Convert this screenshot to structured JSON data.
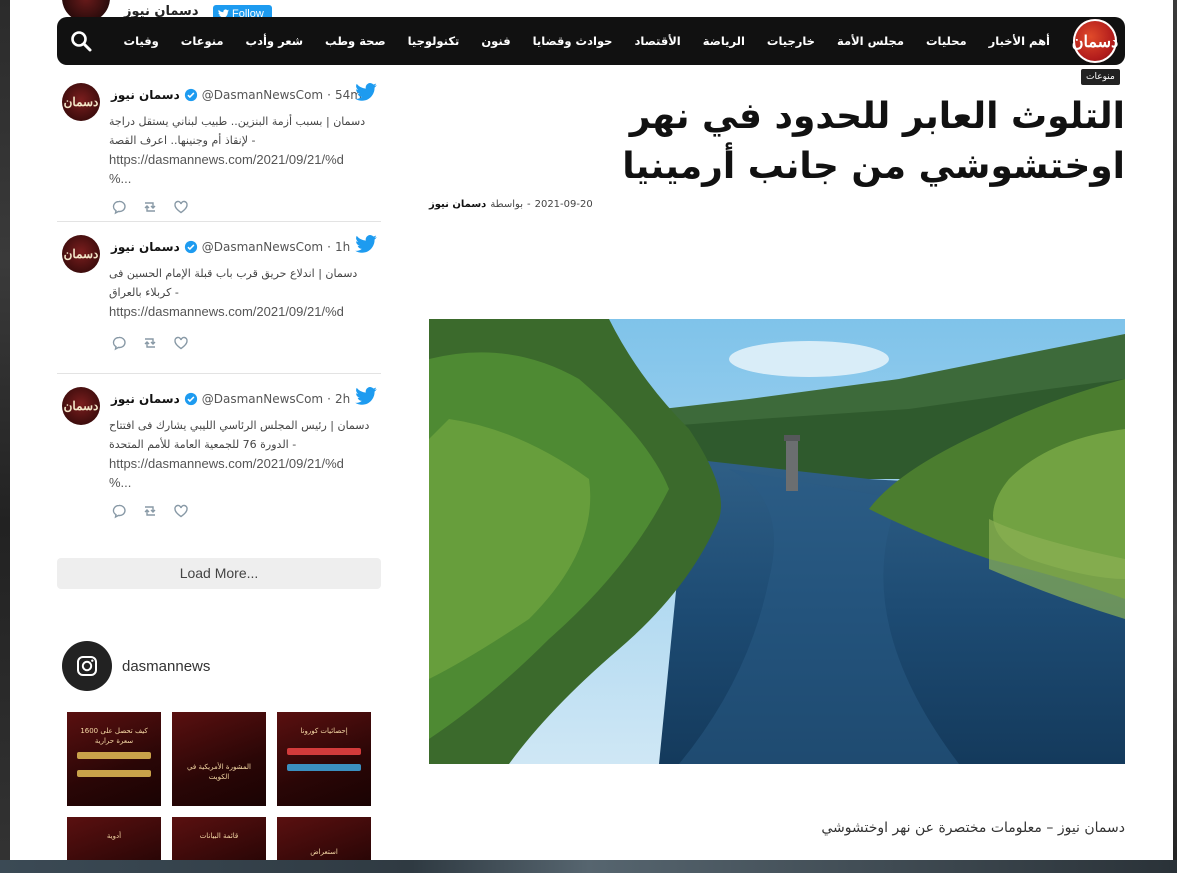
{
  "top_partial": {
    "name": "دسمان نيوز",
    "follow_label": "Follow"
  },
  "nav": {
    "logo_text": "دسمان",
    "items": [
      "أهم الأخبار",
      "محليات",
      "مجلس الأمة",
      "خارجيات",
      "الرياضة",
      "الأقتصاد",
      "حوادث وقضايا",
      "فنون",
      "تكنولوجيا",
      "صحة وطب",
      "شعر وأدب",
      "منوعات",
      "وفيات"
    ]
  },
  "article": {
    "category": "منوعات",
    "title": "التلوث العابر للحدود في نهر اوختشوشي من جانب أرمينيا",
    "date": "2021-09-20",
    "by_label": "بواسطة",
    "author": "دسمان نيوز",
    "separator": "-",
    "caption": "دسمان نيوز – معلومات مختصرة عن نهر اوختشوشي"
  },
  "tweets": [
    {
      "name": "دسمان نيوز",
      "handle": "@DasmanNewsCom",
      "time": "54m",
      "line1": "دسمان | بسبب أزمة البنزين.. طبيب لبناني يستقل دراجة",
      "line2": "- لإنقاذ أم وجنينها.. اعرف القصة",
      "url": "https://dasmannews.com/2021/09/21/%d",
      "url2": "%..."
    },
    {
      "name": "دسمان نيوز",
      "handle": "@DasmanNewsCom",
      "time": "1h",
      "line1": "دسمان | اندلاع حريق قرب باب قبلة الإمام الحسين فى",
      "line2": "- كربلاء بالعراق",
      "url": "https://dasmannews.com/2021/09/21/%d",
      "url2": ""
    },
    {
      "name": "دسمان نيوز",
      "handle": "@DasmanNewsCom",
      "time": "2h",
      "line1": "دسمان | رئيس المجلس الرئاسي الليبي يشارك فى افتتاح",
      "line2": "- الدورة 76 للجمعية العامة للأمم المتحدة",
      "url": "https://dasmannews.com/2021/09/21/%d",
      "url2": "%..."
    }
  ],
  "load_more": "Load More...",
  "instagram": {
    "username": "dasmannews",
    "tiles": [
      "كيف تحصل على 1600 سعرة حرارية",
      "المشورة الأمريكية في الكويت",
      "إحصائيات كورونا",
      "أدوية",
      "قائمة البيانات",
      "استعراض"
    ]
  }
}
